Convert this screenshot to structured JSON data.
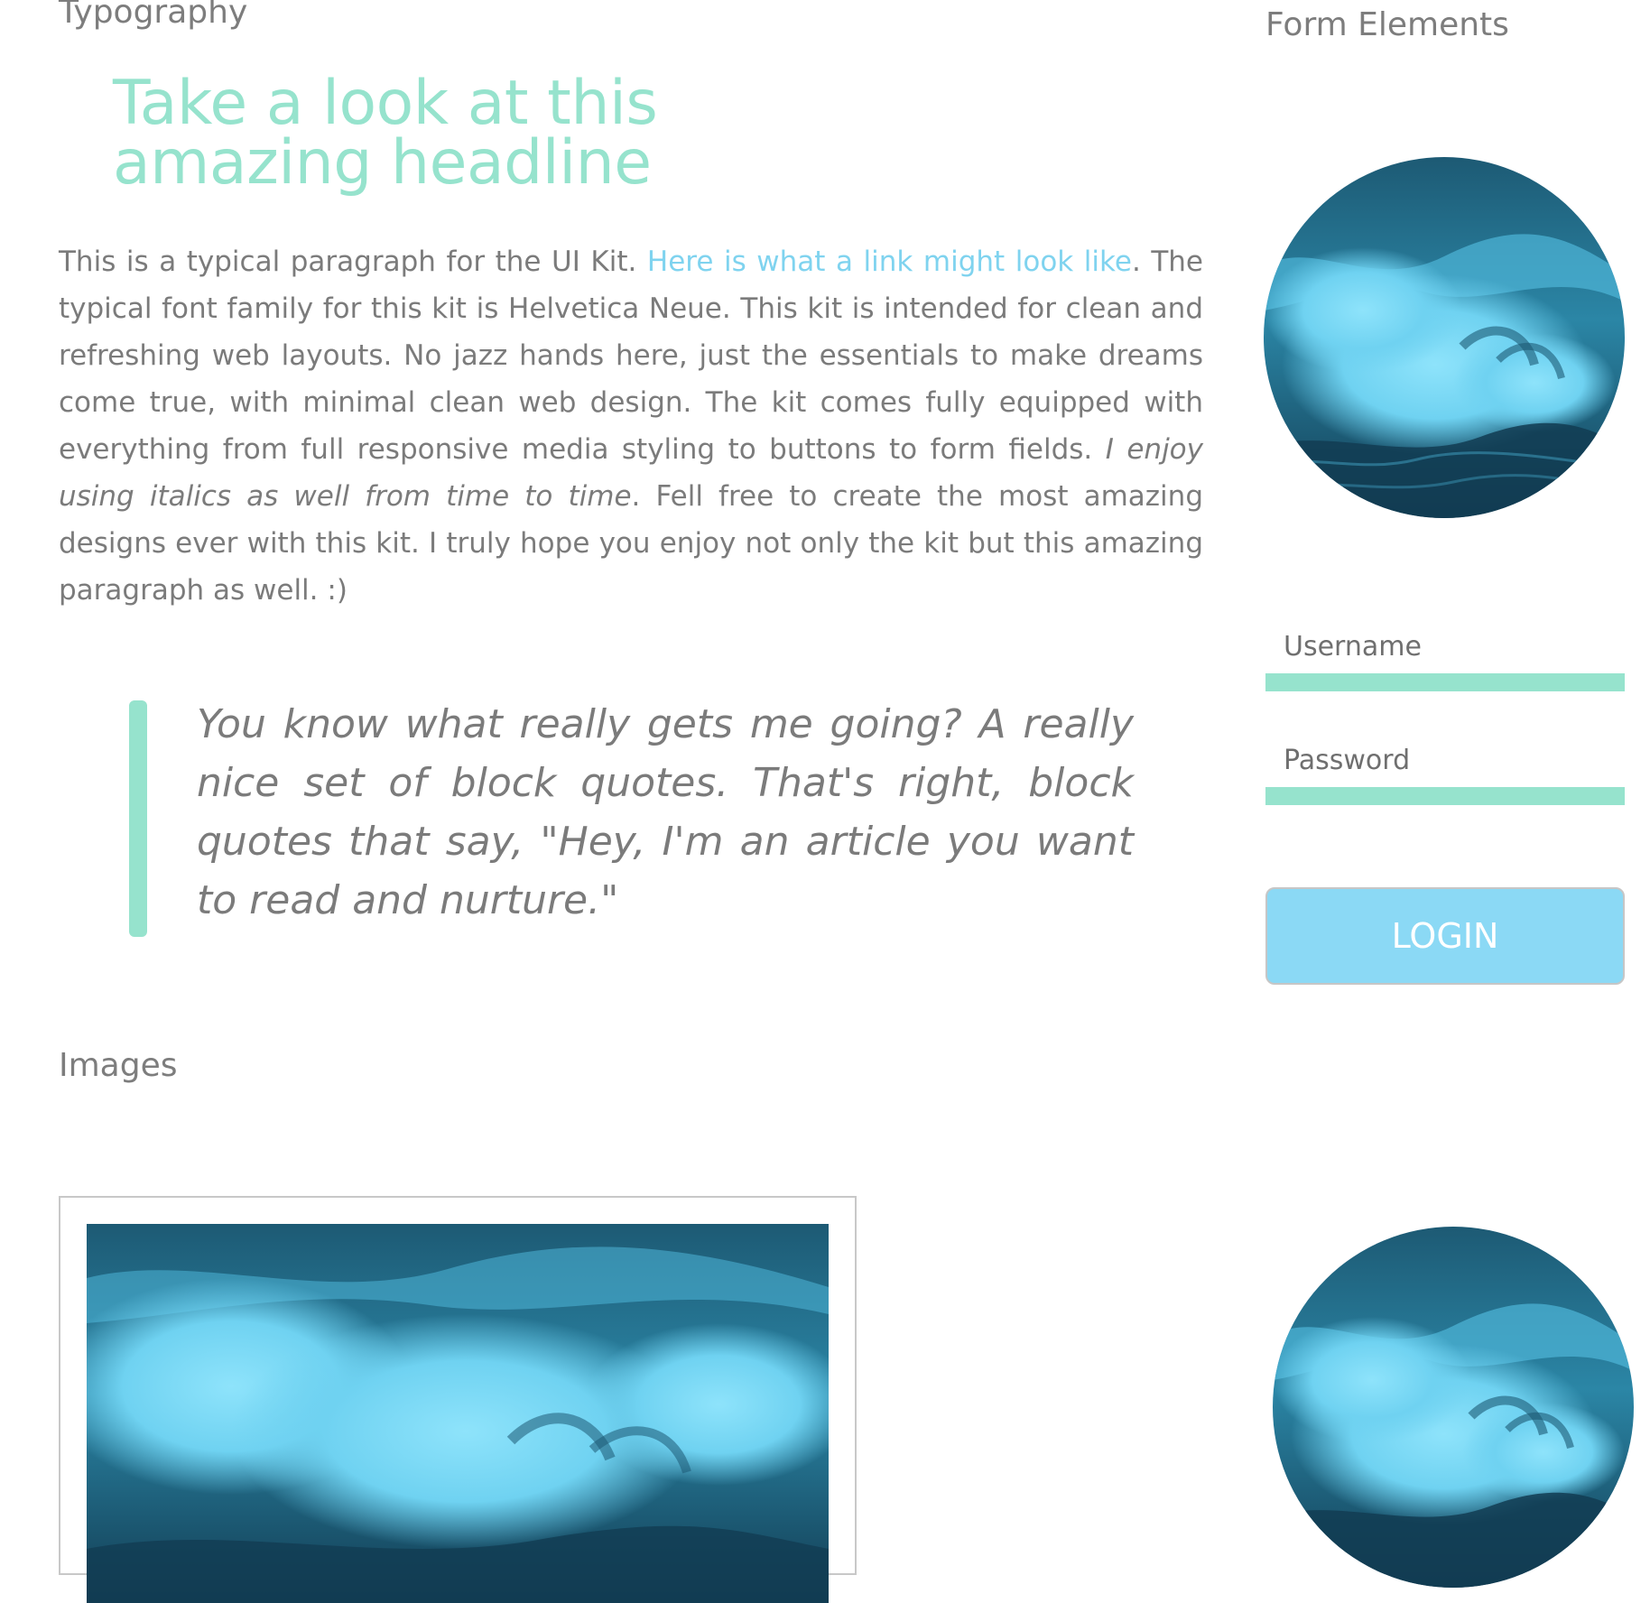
{
  "typography": {
    "section_title": "Typography",
    "headline": "Take a look at this amazing headline",
    "paragraph": {
      "intro": "This is a typical paragraph for the UI Kit. ",
      "link": "Here is what a link might look like",
      "after_link": ". The typical font family for this kit is Helvetica Neue. This kit is intended for clean and refreshing web layouts. No jazz hands here, just the essentials to make dreams come true, with minimal clean web design. The kit comes fully equipped with everything from full responsive media styling to buttons to form fields. ",
      "italic": "I enjoy using italics as well from time to time",
      "ending": ". Fell free to create the most amazing designs ever with this kit. I truly hope you enjoy not only the kit but this amazing paragraph as well. :)"
    },
    "blockquote": "You know what really gets me going? A really nice set of block quotes. That's right, block quotes that say, \"Hey, I'm an article you want to read and nurture.\""
  },
  "form": {
    "section_title": "Form Elements",
    "username_placeholder": "Username",
    "password_placeholder": "Password",
    "login_label": "LOGIN"
  },
  "images": {
    "section_title": "Images"
  },
  "colors": {
    "accent_mint": "#96e3cd",
    "link_blue": "#7fd3ef",
    "button_blue": "#8bd9f5",
    "text_gray": "#7b7b7b"
  }
}
